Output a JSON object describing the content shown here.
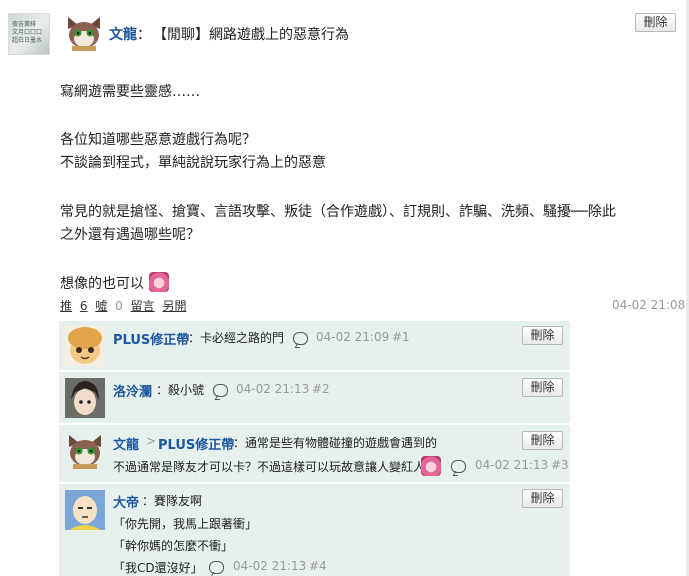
{
  "post": {
    "thumb_text": [
      "夜吉黃緋",
      "文月口口口",
      "超白日墨水"
    ],
    "author": "文龍",
    "colon": "：",
    "title": "【閒聊】網路遊戲上的惡意行為",
    "delete_label": "刪除",
    "lines": [
      "寫網遊需要些靈感……",
      "各位知道哪些惡意遊戲行為呢？",
      "不談論到程式，單純說說玩家行為上的惡意",
      "常見的就是搶怪、搶寶、言語攻擊、叛徒（合作遊戲）、訂規則、詐騙、洗頻、騷擾──除此",
      "之外還有遇過哪些呢？",
      "想像的也可以"
    ],
    "push_label": "推",
    "push_count": "6",
    "boo_label": "噓",
    "boo_count": "0",
    "reply_label": "留言",
    "other_label": "另開",
    "timestamp": "04-02 21:08"
  },
  "replies": [
    {
      "author": "PLUS修正帶",
      "text": "：卡必經之路的門",
      "time": "04-02 21:09",
      "floor": "#1",
      "delete_label": "刪除"
    },
    {
      "author": "洛泠瀾",
      "text": "：殺小號",
      "time": "04-02 21:13",
      "floor": "#2",
      "delete_label": "刪除"
    },
    {
      "author": "文龍",
      "arrow": ">",
      "target": "PLUS修正帶",
      "text": "：通常是些有物體碰撞的遊戲會遇到的",
      "text2": "不過通常是隊友才可以卡？不過這樣可以玩故意讓人變紅人",
      "time": "04-02 21:13",
      "floor": "#3",
      "delete_label": "刪除"
    },
    {
      "author": "大帝",
      "text": "：賽隊友啊",
      "extra_lines": [
        "「你先開，我馬上跟著衝」",
        "「幹你媽的怎麼不衝」",
        "「我CD還沒好」"
      ],
      "time": "04-02 21:13",
      "floor": "#4",
      "delete_label": "刪除"
    }
  ],
  "colors": {
    "name": "#1d57a0",
    "reply_bg": "#e6f1ee",
    "meta": "#999999"
  }
}
